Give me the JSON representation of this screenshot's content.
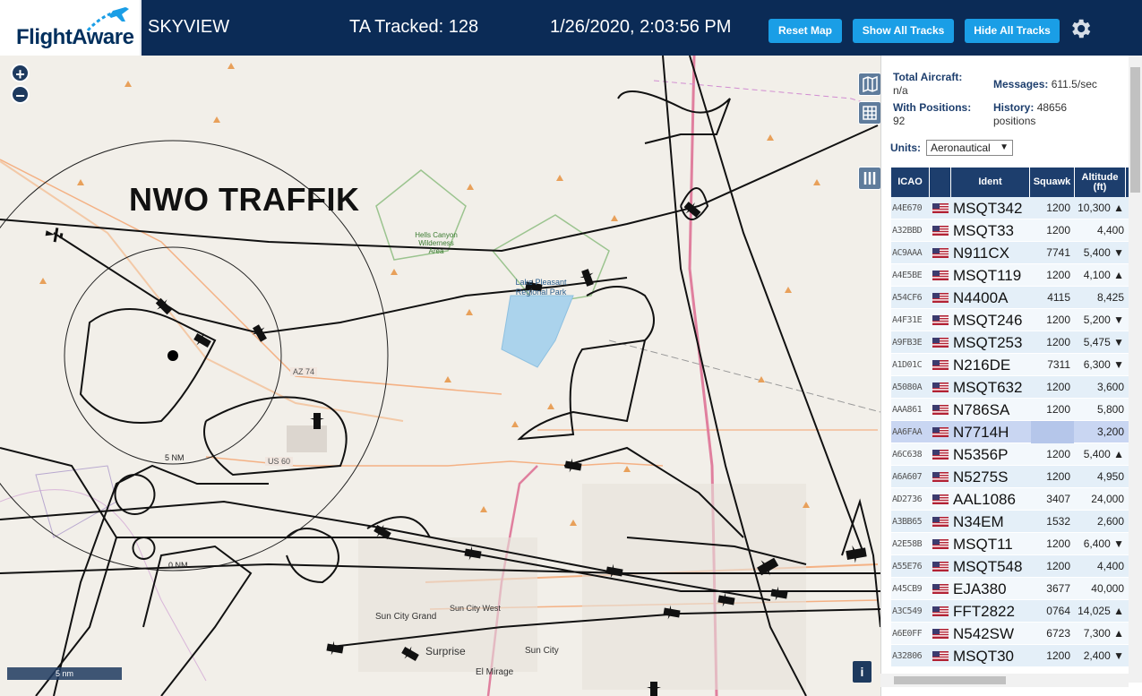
{
  "header": {
    "logo_text": "FlightAware",
    "app_name": "SKYVIEW",
    "tracked": "TA Tracked: 128",
    "datetime": "1/26/2020, 2:03:56 PM",
    "buttons": {
      "reset": "Reset Map",
      "show": "Show All Tracks",
      "hide": "Hide All Tracks"
    },
    "accent": "#1a9ee6",
    "bg": "#0b2b56"
  },
  "map": {
    "annotation": "NWO TRAFFIK",
    "zoom_in": "+",
    "zoom_out": "−",
    "scale_label": "5 nm",
    "info": "i",
    "labels": {
      "hells_canyon": "Hells Canyon Wilderness Area",
      "lake_pleasant": "Lake Pleasant Regional Park",
      "az74": "AZ 74",
      "us60": "US 60",
      "sun_city_grand": "Sun City Grand",
      "sun_city_west": "Sun City West",
      "sun_city": "Sun City",
      "surprise": "Surprise",
      "el_mirage": "El Mirage",
      "nm5": "5 NM",
      "nm0": "0 NM"
    }
  },
  "stats": {
    "total_label": "Total Aircraft:",
    "total_value": "n/a",
    "messages_label": "Messages:",
    "messages_value": "611.5/sec",
    "positions_label": "With Positions:",
    "positions_value": "92",
    "history_label": "History:",
    "history_value": "48656",
    "history_unit": "positions"
  },
  "units": {
    "label": "Units:",
    "selected": "Aeronautical"
  },
  "table": {
    "headers": {
      "icao": "ICAO",
      "ident": "Ident",
      "squawk": "Squawk",
      "altitude": "Altitude (ft)"
    },
    "rows": [
      {
        "icao": "A4E670",
        "ident": "MSQT342",
        "squawk": "1200",
        "alt": "10,300 ▲"
      },
      {
        "icao": "A32BBD",
        "ident": "MSQT33",
        "squawk": "1200",
        "alt": "4,400"
      },
      {
        "icao": "AC9AAA",
        "ident": "N911CX",
        "squawk": "7741",
        "alt": "5,400 ▼"
      },
      {
        "icao": "A4E5BE",
        "ident": "MSQT119",
        "squawk": "1200",
        "alt": "4,100 ▲"
      },
      {
        "icao": "A54CF6",
        "ident": "N4400A",
        "squawk": "4115",
        "alt": "8,425"
      },
      {
        "icao": "A4F31E",
        "ident": "MSQT246",
        "squawk": "1200",
        "alt": "5,200 ▼"
      },
      {
        "icao": "A9FB3E",
        "ident": "MSQT253",
        "squawk": "1200",
        "alt": "5,475 ▼"
      },
      {
        "icao": "A1D01C",
        "ident": "N216DE",
        "squawk": "7311",
        "alt": "6,300 ▼"
      },
      {
        "icao": "A5080A",
        "ident": "MSQT632",
        "squawk": "1200",
        "alt": "3,600"
      },
      {
        "icao": "AAA861",
        "ident": "N786SA",
        "squawk": "1200",
        "alt": "5,800"
      },
      {
        "icao": "AA6FAA",
        "ident": "N7714H",
        "squawk": "",
        "alt": "3,200"
      },
      {
        "icao": "A6C638",
        "ident": "N5356P",
        "squawk": "1200",
        "alt": "5,400 ▲"
      },
      {
        "icao": "A6A607",
        "ident": "N5275S",
        "squawk": "1200",
        "alt": "4,950"
      },
      {
        "icao": "AD2736",
        "ident": "AAL1086",
        "squawk": "3407",
        "alt": "24,000"
      },
      {
        "icao": "A3BB65",
        "ident": "N34EM",
        "squawk": "1532",
        "alt": "2,600"
      },
      {
        "icao": "A2E58B",
        "ident": "MSQT11",
        "squawk": "1200",
        "alt": "6,400 ▼"
      },
      {
        "icao": "A55E76",
        "ident": "MSQT548",
        "squawk": "1200",
        "alt": "4,400"
      },
      {
        "icao": "A45CB9",
        "ident": "EJA380",
        "squawk": "3677",
        "alt": "40,000"
      },
      {
        "icao": "A3C549",
        "ident": "FFT2822",
        "squawk": "0764",
        "alt": "14,025 ▲"
      },
      {
        "icao": "A6E0FF",
        "ident": "N542SW",
        "squawk": "6723",
        "alt": "7,300 ▲"
      },
      {
        "icao": "A32806",
        "ident": "MSQT30",
        "squawk": "1200",
        "alt": "2,400 ▼"
      }
    ]
  }
}
